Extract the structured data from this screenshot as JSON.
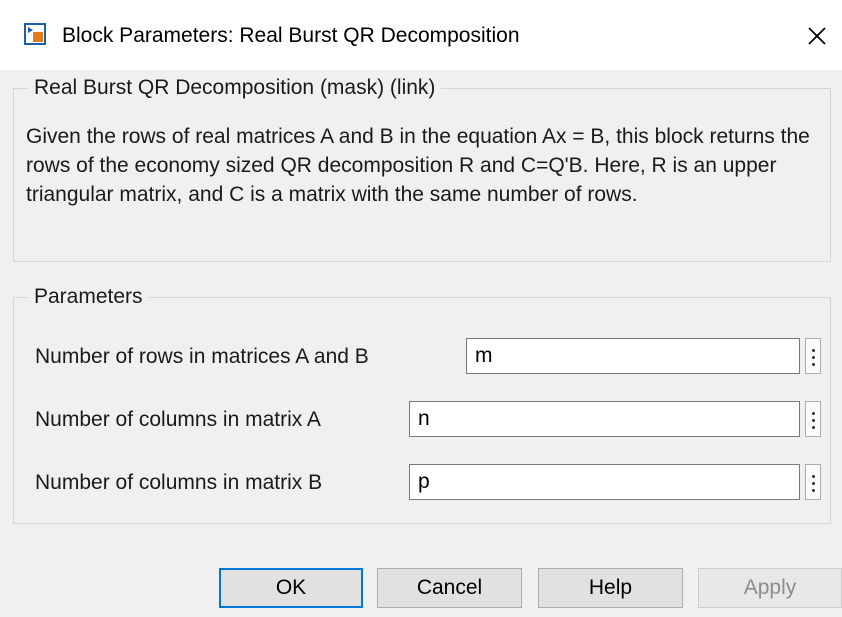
{
  "window": {
    "title": "Block Parameters: Real Burst QR Decomposition",
    "icon": "simulink-block-icon",
    "close_icon": "close-icon"
  },
  "mask": {
    "group_title": "Real Burst QR Decomposition (mask) (link)",
    "description": "Given the rows of real matrices A and B in the equation Ax = B, this block returns the rows of the economy sized QR decomposition R and C=Q'B. Here, R is an upper triangular matrix, and C is a matrix with the same number of rows."
  },
  "parameters": {
    "group_title": "Parameters",
    "rows": [
      {
        "label": "Number of rows in matrices A and B",
        "value": "m"
      },
      {
        "label": "Number of columns in matrix A",
        "value": "n"
      },
      {
        "label": "Number of columns in matrix B",
        "value": "p"
      }
    ]
  },
  "buttons": {
    "ok": "OK",
    "cancel": "Cancel",
    "help": "Help",
    "apply": "Apply"
  },
  "colors": {
    "accent": "#0078d7",
    "panel": "#f0f0f0"
  }
}
